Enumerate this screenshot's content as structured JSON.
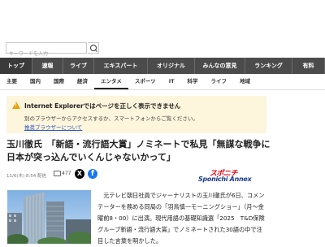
{
  "search": {
    "placeholder": "キーワードを入力"
  },
  "topnav": {
    "items": [
      "トップ",
      "速報",
      "ライブ",
      "エキスパート",
      "オリジナル",
      "みんなの意見",
      "ランキング",
      "有料"
    ],
    "active": 0
  },
  "subnav": {
    "items": [
      "主要",
      "国内",
      "国際",
      "経済",
      "エンタメ",
      "スポーツ",
      "IT",
      "科学",
      "ライフ",
      "地域"
    ],
    "active": 4
  },
  "notice": {
    "title": "Internet Explorerではページを正しく表示できません",
    "message": "別のブラウザーからアクセスするか、スマートフォンからご覧ください。",
    "link": "推奨ブラウザーについて"
  },
  "article": {
    "headline": "玉川徹氏　「新語・流行語大賞」ノミネートで私見「無謀な戦争に日本が突っ込んでいくんじゃないかって」",
    "timestamp": "11/6(木) 8:54 配信",
    "comment_count": "477",
    "source_logo_top": "スポニチ",
    "source_logo_bottom": "Sponichi Annex",
    "body": "　元テレビ朝日社員でジャーナリストの玉川徹氏が6日、コメンテーターを務める同局の「羽鳥慎一モーニングショー」（月～金曜前8・00）に出演。現代用語の基礎知識選「2025　T&D保険グループ新語・流行語大賞」でノミネートされた30語の中で注目した言葉を明かした。"
  },
  "colors": {
    "topnav_bg": "#4b4b4b",
    "notice_bg": "#fdf5dc",
    "warning": "#e8a10c",
    "link": "#2a56c6",
    "logo_red": "#e60012",
    "logo_blue": "#1a3c8c"
  }
}
